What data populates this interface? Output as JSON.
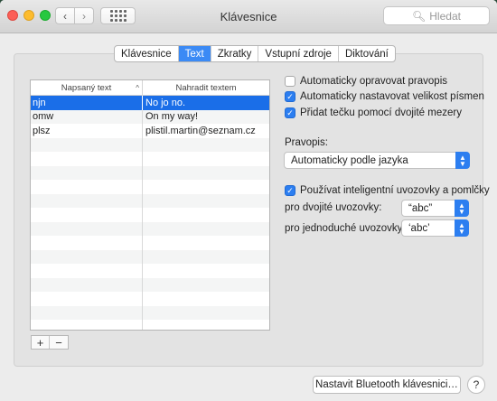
{
  "window": {
    "title": "Klávesnice",
    "search_placeholder": "Hledat"
  },
  "tabs": [
    {
      "label": "Klávesnice",
      "active": false
    },
    {
      "label": "Text",
      "active": true
    },
    {
      "label": "Zkratky",
      "active": false
    },
    {
      "label": "Vstupní zdroje",
      "active": false
    },
    {
      "label": "Diktování",
      "active": false
    }
  ],
  "table": {
    "headers": {
      "col1": "Napsaný text",
      "col2": "Nahradit textem"
    },
    "sort_indicator": "^",
    "rows": [
      {
        "typed": "njn",
        "replace": "No jo no.",
        "selected": true
      },
      {
        "typed": "omw",
        "replace": "On my way!",
        "selected": false
      },
      {
        "typed": "plsz",
        "replace": "plistil.martin@seznam.cz",
        "selected": false
      }
    ]
  },
  "buttons": {
    "add": "+",
    "remove": "−",
    "bluetooth": "Nastavit Bluetooth klávesnici…",
    "help": "?"
  },
  "options": {
    "autocorrect": {
      "label": "Automaticky opravovat pravopis",
      "checked": false
    },
    "autocapitalize": {
      "label": "Automaticky nastavovat velikost písmen",
      "checked": true
    },
    "period_double_space": {
      "label": "Přidat tečku pomocí dvojité mezery",
      "checked": true
    }
  },
  "spelling": {
    "label": "Pravopis:",
    "value": "Automaticky podle jazyka"
  },
  "smart_quotes": {
    "label": "Používat inteligentní uvozovky a pomlčky",
    "checked": true,
    "double_label": "pro dvojité uvozovky:",
    "double_value": "“abc”",
    "single_label": "pro jednoduché uvozovky:",
    "single_value": "‘abc’"
  },
  "colors": {
    "accent": "#2c7ef0",
    "selection": "#1a6ee8"
  }
}
